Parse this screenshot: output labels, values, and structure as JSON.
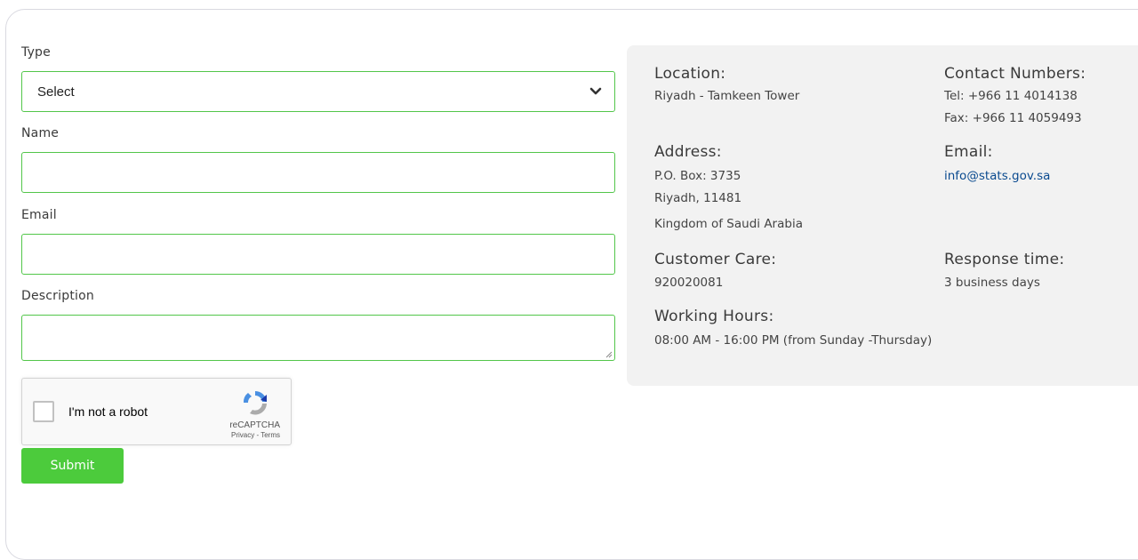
{
  "form": {
    "type_label": "Type",
    "type_value": "Select",
    "name_label": "Name",
    "email_label": "Email",
    "description_label": "Description",
    "captcha_label": "I'm not a robot",
    "captcha_brand": "reCAPTCHA",
    "captcha_terms": "Privacy - Terms",
    "submit_label": "Submit"
  },
  "info": {
    "location_title": "Location:",
    "location_value": "Riyadh - Tamkeen Tower",
    "contact_title": "Contact Numbers:",
    "tel_value": "Tel: +966 11 4014138",
    "fax_value": "Fax: +966 11 4059493",
    "address_title": "Address:",
    "address_line1": "P.O. Box: 3735",
    "address_line2": "Riyadh, 11481",
    "address_line3": "Kingdom of Saudi Arabia",
    "email_title": "Email:",
    "email_value": "info@stats.gov.sa",
    "care_title": "Customer Care:",
    "care_value": "920020081",
    "response_title": "Response time:",
    "response_value": "3 business days",
    "hours_title": "Working Hours:",
    "hours_value": "08:00 AM - 16:00 PM (from Sunday -Thursday)"
  },
  "colors": {
    "accent_green": "#4ccb3c",
    "field_border": "#52c64a",
    "info_bg": "#f2f2f2",
    "link": "#0a4a8f"
  },
  "icons": [
    "chevron-down-icon",
    "recaptcha-logo-icon",
    "resize-handle-icon"
  ]
}
